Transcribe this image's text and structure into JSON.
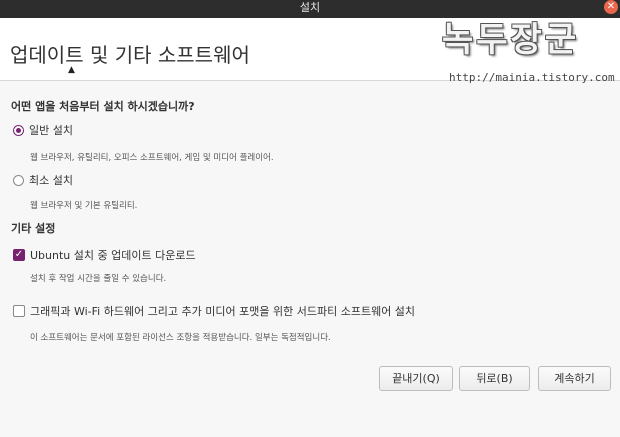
{
  "window": {
    "title": "설치"
  },
  "header": {
    "title": "업데이트 및 기타 소프트웨어"
  },
  "watermark": {
    "title": "녹두장군",
    "url": "http://mainia.tistory.com"
  },
  "question": "어떤 앱을 처음부터 설치 하시겠습니까?",
  "install_options": [
    {
      "label": "일반 설치",
      "selected": true,
      "description": "웹 브라우저, 유틸리티, 오피스  소프트웨어, 게임 및 미디어 플레이어."
    },
    {
      "label": "최소 설치",
      "selected": false,
      "description": "웹 브라우저 및 기본 유틸리티."
    }
  ],
  "other_settings": {
    "heading": "기타 설정",
    "options": [
      {
        "label": "Ubuntu 설치 중 업데이트 다운로드",
        "checked": true,
        "description": "설치 후 작업 시간을 줄일 수 있습니다."
      },
      {
        "label": "그래픽과 Wi-Fi 하드웨어 그리고 추가 미디어 포맷을 위한 서드파티 소프트웨어 설치",
        "checked": false,
        "description": "이 소프트웨어는 문서에 포함된 라이선스 조항을 적용받습니다. 일부는 독점적입니다."
      }
    ]
  },
  "buttons": {
    "quit": "끝내기(Q)",
    "back": "뒤로(B)",
    "continue": "계속하기"
  },
  "icons": {
    "close": "close-icon",
    "checkmark": "checkmark-icon",
    "cursor": "mouse-pointer-icon"
  },
  "colors": {
    "accent": "#77216f",
    "close": "#e9674d",
    "titlebar": "#2d2d2d"
  }
}
